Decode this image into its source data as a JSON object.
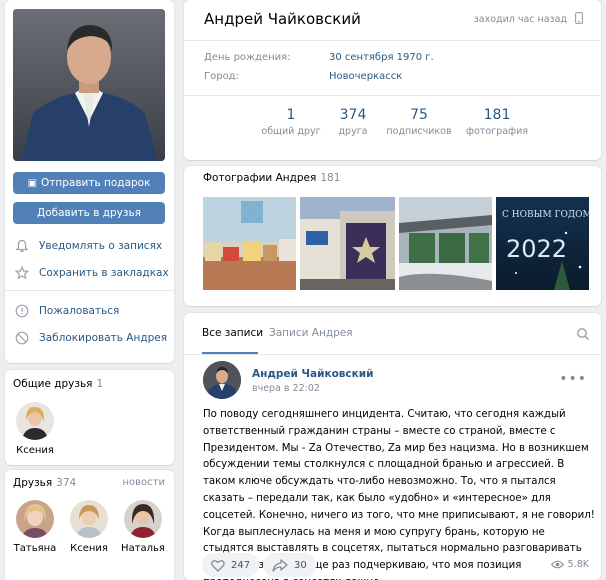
{
  "profile": {
    "name": "Андрей Чайковский",
    "last_seen": "заходил час назад",
    "birthday_label": "День рождения:",
    "birthday_value": "30 сентября 1970 г.",
    "city_label": "Город:",
    "city_value": "Новочеркасск",
    "counters": [
      {
        "num": "1",
        "label": "общий друг"
      },
      {
        "num": "374",
        "label": "друга"
      },
      {
        "num": "75",
        "label": "подписчиков"
      },
      {
        "num": "181",
        "label": "фотография"
      }
    ]
  },
  "actions": {
    "send_gift": "Отправить подарок",
    "add_friend": "Добавить в друзья",
    "notify": "Уведомлять о записях",
    "bookmark": "Сохранить в закладках",
    "report": "Пожаловаться",
    "block": "Заблокировать Андрея"
  },
  "common_friends": {
    "title": "Общие друзья",
    "count": "1",
    "items": [
      {
        "name": "Ксения"
      }
    ]
  },
  "friends": {
    "title": "Друзья",
    "count": "374",
    "news_link": "новости",
    "items": [
      {
        "name": "Татьяна"
      },
      {
        "name": "Ксения"
      },
      {
        "name": "Наталья"
      }
    ]
  },
  "photos": {
    "title": "Фотографии Андрея",
    "count": "181",
    "thumb4_text_top": "С НОВЫМ ГОДОМ",
    "thumb4_text_year": "2022"
  },
  "wall": {
    "tabs": [
      "Все записи",
      "Записи Андрея"
    ],
    "post": {
      "author": "Андрей Чайковский",
      "time": "вчера в 22:02",
      "text": "По поводу сегодняшнего инцидента. Считаю, что сегодня каждый ответственный гражданин страны – вместе со страной, вместе с Президентом. Мы - Zа Отечество, Zа мир без нацизма. Но в возникшем обсуждении темы столкнулся с площадной бранью и агрессией. В таком ключе обсуждать что-либо невозможно. То, что я пытался сказать – передали так, как было «удобно» и «интересное» для соцсетей. Конечно, ничего из того, что мне приписывают, я не говорил! Когда выплеснулась на меня и мою супругу брань, которую не стыдятся выставлять в соцсетях, пытаться нормально разговаривать было невозможно. Еще раз подчеркиваю, что моя позиция преподнесена в соцсетях ложно.",
      "likes": "247",
      "shares": "30",
      "views": "5.8K"
    }
  },
  "colors": {
    "accent": "#5181b8",
    "link": "#2a5885",
    "muted": "#818c99",
    "background": "#edeef0"
  }
}
